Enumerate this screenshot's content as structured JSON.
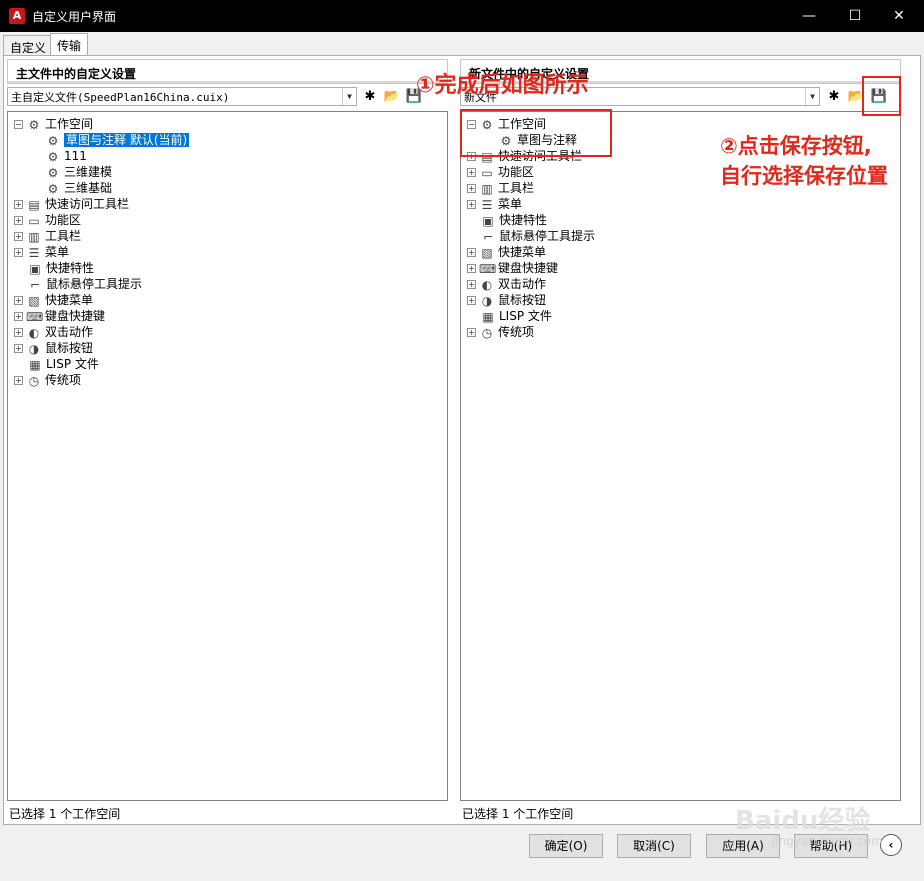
{
  "window": {
    "title": "自定义用户界面",
    "minimize_glyph": "—",
    "maximize_glyph": "☐",
    "close_glyph": "✕"
  },
  "tabs": [
    "自定义",
    "传输"
  ],
  "left": {
    "header": "主文件中的自定义设置",
    "combo_value": "主自定义文件(SpeedPlan16China.cuix)",
    "tree": [
      {
        "label": "工作空间",
        "level": 0,
        "exp": "−",
        "icon": "⚙"
      },
      {
        "label": "草图与注释 默认(当前)",
        "level": 1,
        "exp": "",
        "icon": "⚙",
        "selected": true
      },
      {
        "label": "111",
        "level": 1,
        "exp": "",
        "icon": "⚙"
      },
      {
        "label": "三维建模",
        "level": 1,
        "exp": "",
        "icon": "⚙"
      },
      {
        "label": "三维基础",
        "level": 1,
        "exp": "",
        "icon": "⚙"
      },
      {
        "label": "快速访问工具栏",
        "level": 0,
        "exp": "+",
        "icon": "▤"
      },
      {
        "label": "功能区",
        "level": 0,
        "exp": "+",
        "icon": "▭"
      },
      {
        "label": "工具栏",
        "level": 0,
        "exp": "+",
        "icon": "▥"
      },
      {
        "label": "菜单",
        "level": 0,
        "exp": "+",
        "icon": "☰"
      },
      {
        "label": "快捷特性",
        "level": 0,
        "exp": "",
        "icon": "▣"
      },
      {
        "label": "鼠标悬停工具提示",
        "level": 0,
        "exp": "",
        "icon": "⌐"
      },
      {
        "label": "快捷菜单",
        "level": 0,
        "exp": "+",
        "icon": "▧"
      },
      {
        "label": "键盘快捷键",
        "level": 0,
        "exp": "+",
        "icon": "⌨"
      },
      {
        "label": "双击动作",
        "level": 0,
        "exp": "+",
        "icon": "◐"
      },
      {
        "label": "鼠标按钮",
        "level": 0,
        "exp": "+",
        "icon": "◑"
      },
      {
        "label": "LISP 文件",
        "level": 0,
        "exp": "",
        "icon": "▦"
      },
      {
        "label": "传统项",
        "level": 0,
        "exp": "+",
        "icon": "◷"
      }
    ],
    "status": "已选择 1 个工作空间"
  },
  "right": {
    "header": "新文件中的自定义设置",
    "combo_value": "新文件",
    "tree": [
      {
        "label": "工作空间",
        "level": 0,
        "exp": "−",
        "icon": "⚙"
      },
      {
        "label": "草图与注释",
        "level": 1,
        "exp": "",
        "icon": "⚙"
      },
      {
        "label": "快速访问工具栏",
        "level": 0,
        "exp": "+",
        "icon": "▤"
      },
      {
        "label": "功能区",
        "level": 0,
        "exp": "+",
        "icon": "▭"
      },
      {
        "label": "工具栏",
        "level": 0,
        "exp": "+",
        "icon": "▥"
      },
      {
        "label": "菜单",
        "level": 0,
        "exp": "+",
        "icon": "☰"
      },
      {
        "label": "快捷特性",
        "level": 0,
        "exp": "",
        "icon": "▣"
      },
      {
        "label": "鼠标悬停工具提示",
        "level": 0,
        "exp": "",
        "icon": "⌐"
      },
      {
        "label": "快捷菜单",
        "level": 0,
        "exp": "+",
        "icon": "▧"
      },
      {
        "label": "键盘快捷键",
        "level": 0,
        "exp": "+",
        "icon": "⌨"
      },
      {
        "label": "双击动作",
        "level": 0,
        "exp": "+",
        "icon": "◐"
      },
      {
        "label": "鼠标按钮",
        "level": 0,
        "exp": "+",
        "icon": "◑"
      },
      {
        "label": "LISP 文件",
        "level": 0,
        "exp": "",
        "icon": "▦"
      },
      {
        "label": "传统项",
        "level": 0,
        "exp": "+",
        "icon": "◷"
      }
    ],
    "status": "已选择 1 个工作空间"
  },
  "toolbar_icons": {
    "new": "new-file-icon",
    "open": "open-folder-icon",
    "save": "save-disk-icon"
  },
  "buttons": {
    "ok": "确定(O)",
    "cancel": "取消(C)",
    "apply": "应用(A)",
    "help": "帮助(H)",
    "nav": "‹"
  },
  "annotations": {
    "step1": "①完成后如图所示",
    "step2_line1": "②点击保存按钮,",
    "step2_line2": "自行选择保存位置"
  },
  "watermark": {
    "brand": "Baidu经验",
    "url": "jingyan.baidu.com"
  },
  "colors": {
    "selection": "#0078d7",
    "annotation": "#e5261b",
    "titlebar": "#000000"
  }
}
